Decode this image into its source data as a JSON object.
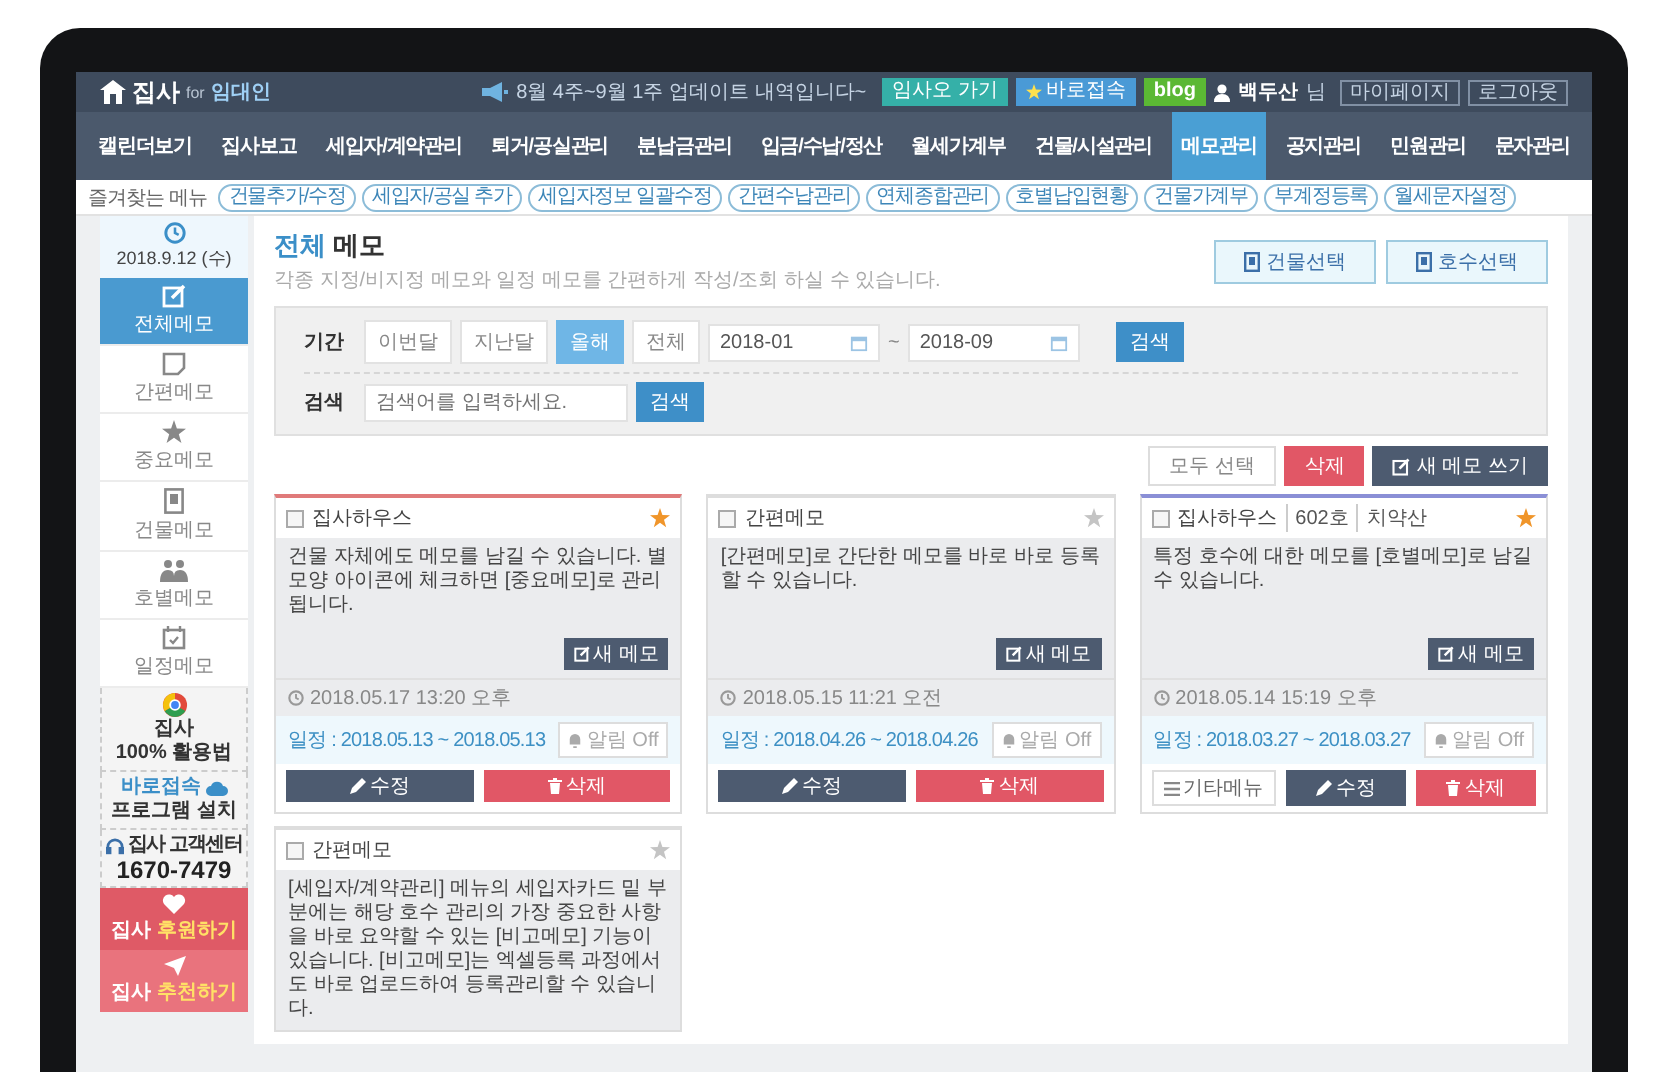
{
  "topbar": {
    "logo": "집사",
    "logo_for": "for",
    "logo_sub": "임대인",
    "notice": "8월 4주~9월 1주 업데이트 내역입니다~",
    "links": [
      {
        "label": "임사오 가기",
        "kind": "teal"
      },
      {
        "label": "바로접속",
        "kind": "star"
      },
      {
        "label": "blog",
        "kind": "blog"
      }
    ],
    "user": "백두산",
    "user_suffix": "님",
    "account_links": [
      "마이페이지",
      "로그아웃"
    ]
  },
  "nav": [
    {
      "label": "캘린더보기",
      "selected": false
    },
    {
      "label": "집사보고",
      "selected": false
    },
    {
      "label": "세입자/계약관리",
      "selected": false
    },
    {
      "label": "퇴거/공실관리",
      "selected": false
    },
    {
      "label": "분납금관리",
      "selected": false
    },
    {
      "label": "입금/수납/정산",
      "selected": false
    },
    {
      "label": "월세가계부",
      "selected": false
    },
    {
      "label": "건물/시설관리",
      "selected": false
    },
    {
      "label": "메모관리",
      "selected": true
    },
    {
      "label": "공지관리",
      "selected": false
    },
    {
      "label": "민원관리",
      "selected": false
    },
    {
      "label": "문자관리",
      "selected": false
    }
  ],
  "favorites": {
    "label": "즐겨찾는 메뉴",
    "items": [
      "건물추가/수정",
      "세입자/공실 추가",
      "세입자정보 일괄수정",
      "간편수납관리",
      "연체종합관리",
      "호별납입현황",
      "건물가계부",
      "부계정등록",
      "월세문자설정"
    ]
  },
  "sidebar": {
    "date": "2018.9.12 (수)",
    "items": [
      {
        "label": "전체메모",
        "selected": true
      },
      {
        "label": "간편메모",
        "selected": false
      },
      {
        "label": "중요메모",
        "selected": false
      },
      {
        "label": "건물메모",
        "selected": false
      },
      {
        "label": "호별메모",
        "selected": false
      },
      {
        "label": "일정메모",
        "selected": false
      }
    ],
    "guide_brand": "집사",
    "guide_text": "100% 활용법",
    "install_accent": "바로접속",
    "install_text": "프로그램 설치",
    "support_label": "집사 고객센터",
    "support_phone": "1670-7479",
    "actions": [
      {
        "brand": "집사",
        "label": "후원하기"
      },
      {
        "brand": "집사",
        "label": "추천하기"
      }
    ]
  },
  "page": {
    "title_accent": "전체",
    "title_rest": "메모",
    "description": "각종 지정/비지정 메모와 일정 메모를 간편하게 작성/조회 하실 수 있습니다.",
    "buttons": [
      "건물선택",
      "호수선택"
    ]
  },
  "filter": {
    "period_label": "기간",
    "periods": [
      {
        "label": "이번달",
        "selected": false
      },
      {
        "label": "지난달",
        "selected": false
      },
      {
        "label": "올해",
        "selected": true
      },
      {
        "label": "전체",
        "selected": false
      }
    ],
    "date_from": "2018-01",
    "separator": "~",
    "date_to": "2018-09",
    "period_button": "검색",
    "search_label": "검색",
    "search_placeholder": "검색어를 입력하세요.",
    "search_button": "검색"
  },
  "actions": [
    {
      "label": "모두 선택",
      "kind": "plain"
    },
    {
      "label": "삭제",
      "kind": "danger"
    },
    {
      "label": "새 메모 쓰기",
      "kind": "dark"
    }
  ],
  "memos": [
    {
      "title": "집사하우스",
      "checked": false,
      "starred": true,
      "color": "#e07a7a",
      "text": "건물 자체에도 메모를 남길 수 있습니다. 별 모양 아이콘에 체크하면 [중요메모]로 관리됩니다.",
      "new_button": "새 메모",
      "timestamp": "2018.05.17 13:20 오후",
      "schedule": "일정 : 2018.05.13 ~ 2018.05.13",
      "alarm": "알림 Off",
      "buttons": [
        {
          "label": "수정",
          "kind": "edit"
        },
        {
          "label": "삭제",
          "kind": "delete"
        }
      ]
    },
    {
      "title": "간편메모",
      "checked": false,
      "starred": false,
      "color": "#dddddd",
      "text": "[간편메모]로 간단한 메모를 바로 바로 등록할 수 있습니다.",
      "new_button": "새 메모",
      "timestamp": "2018.05.15 11:21 오전",
      "schedule": "일정 : 2018.04.26 ~ 2018.04.26",
      "alarm": "알림 Off",
      "buttons": [
        {
          "label": "수정",
          "kind": "edit"
        },
        {
          "label": "삭제",
          "kind": "delete"
        }
      ]
    },
    {
      "title": "집사하우스",
      "room": "602호",
      "tenant": "치약산",
      "checked": false,
      "starred": true,
      "color": "#8a8fd6",
      "text": "특정 호수에 대한 메모를 [호별메모]로 남길 수 있습니다.",
      "new_button": "새 메모",
      "timestamp": "2018.05.14 15:19 오후",
      "schedule": "일정 : 2018.03.27 ~ 2018.03.27",
      "alarm": "알림 Off",
      "buttons": [
        {
          "label": "기타메뉴",
          "kind": "more"
        },
        {
          "label": "수정",
          "kind": "edit"
        },
        {
          "label": "삭제",
          "kind": "delete"
        }
      ]
    },
    {
      "title": "간편메모",
      "checked": false,
      "starred": false,
      "color": "#dddddd",
      "text": "[세입자/계약관리] 메뉴의 세입자카드 밑 부분에는 해당 호수 관리의 가장 중요한 사항을 바로 요약할 수 있는 [비고메모] 기능이 있습니다. [비고메모]는 엑셀등록 과정에서도 바로 업로드하여 등록관리할 수 있습니다."
    }
  ]
}
